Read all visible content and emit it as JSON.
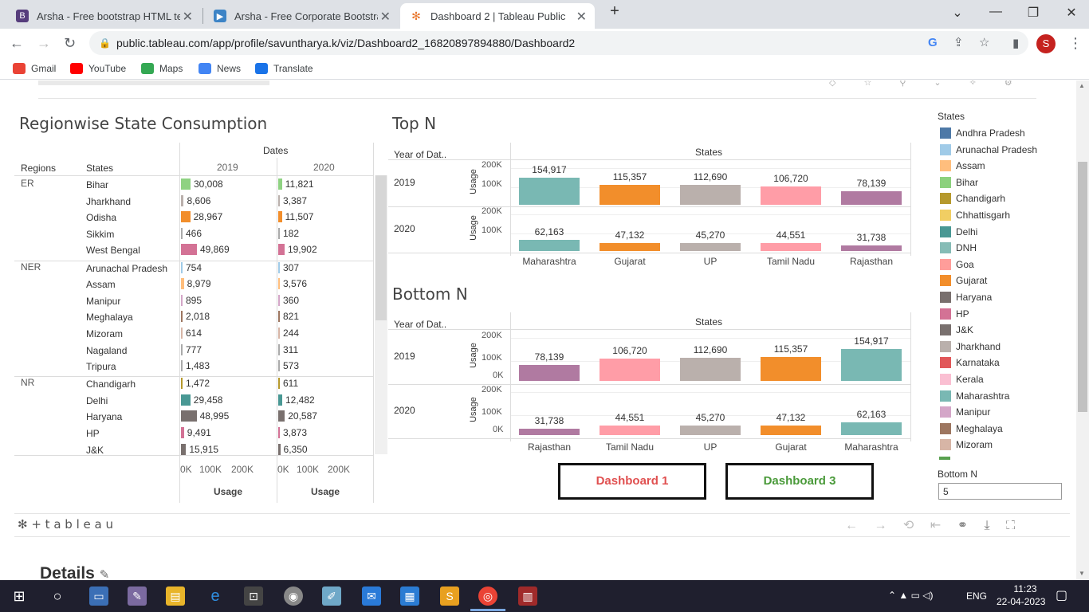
{
  "browser": {
    "tabs": [
      {
        "title": "Arsha - Free bootstrap HTML ten",
        "icon": "bootstrap-icon"
      },
      {
        "title": "Arsha - Free Corporate Bootstrap",
        "icon": "site-icon"
      },
      {
        "title": "Dashboard 2 | Tableau Public",
        "icon": "tableau-icon"
      }
    ],
    "url": "public.tableau.com/app/profile/savuntharya.k/viz/Dashboard2_16820897894880/Dashboard2",
    "avatar": "S",
    "bookmarks": [
      {
        "label": "Gmail",
        "color": "#ea4335"
      },
      {
        "label": "YouTube",
        "color": "#ff0000"
      },
      {
        "label": "Maps",
        "color": "#34a853"
      },
      {
        "label": "News",
        "color": "#4285f4"
      },
      {
        "label": "Translate",
        "color": "#4285f4"
      }
    ]
  },
  "page": {
    "details_label": "Details"
  },
  "viz": {
    "regionwise": {
      "title": "Regionwise State Consumption",
      "dates_header": "Dates",
      "col_regions": "Regions",
      "col_states": "States",
      "years": [
        "2019",
        "2020"
      ],
      "axis_ticks": [
        "0K",
        "100K",
        "200K"
      ],
      "axis_title": "Usage",
      "groups": [
        {
          "region": "ER",
          "rows": [
            {
              "state": "Bihar",
              "v2019": "30,008",
              "v2020": "11,821",
              "n2019": 30008,
              "n2020": 11821,
              "color": "#8fd282"
            },
            {
              "state": "Jharkhand",
              "v2019": "8,606",
              "v2020": "3,387",
              "n2019": 8606,
              "n2020": 3387,
              "color": "#bab0ac"
            },
            {
              "state": "Odisha",
              "v2019": "28,967",
              "v2020": "11,507",
              "n2019": 28967,
              "n2020": 11507,
              "color": "#f28e2b"
            },
            {
              "state": "Sikkim",
              "v2019": "466",
              "v2020": "182",
              "n2019": 466,
              "n2020": 182,
              "color": "#aaaaaa"
            },
            {
              "state": "West Bengal",
              "v2019": "49,869",
              "v2020": "19,902",
              "n2019": 49869,
              "n2020": 19902,
              "color": "#d37295"
            }
          ]
        },
        {
          "region": "NER",
          "rows": [
            {
              "state": "Arunachal Pradesh",
              "v2019": "754",
              "v2020": "307",
              "n2019": 754,
              "n2020": 307,
              "color": "#a0cbe8"
            },
            {
              "state": "Assam",
              "v2019": "8,979",
              "v2020": "3,576",
              "n2019": 8979,
              "n2020": 3576,
              "color": "#ffbe7d"
            },
            {
              "state": "Manipur",
              "v2019": "895",
              "v2020": "360",
              "n2019": 895,
              "n2020": 360,
              "color": "#d4a6c8"
            },
            {
              "state": "Meghalaya",
              "v2019": "2,018",
              "v2020": "821",
              "n2019": 2018,
              "n2020": 821,
              "color": "#9d7660"
            },
            {
              "state": "Mizoram",
              "v2019": "614",
              "v2020": "244",
              "n2019": 614,
              "n2020": 244,
              "color": "#d7b5a6"
            },
            {
              "state": "Nagaland",
              "v2019": "777",
              "v2020": "311",
              "n2019": 777,
              "n2020": 311,
              "color": "#aaaaaa"
            },
            {
              "state": "Tripura",
              "v2019": "1,483",
              "v2020": "573",
              "n2019": 1483,
              "n2020": 573,
              "color": "#aaaaaa"
            }
          ]
        },
        {
          "region": "NR",
          "rows": [
            {
              "state": "Chandigarh",
              "v2019": "1,472",
              "v2020": "611",
              "n2019": 1472,
              "n2020": 611,
              "color": "#b6992d"
            },
            {
              "state": "Delhi",
              "v2019": "29,458",
              "v2020": "12,482",
              "n2019": 29458,
              "n2020": 12482,
              "color": "#499894"
            },
            {
              "state": "Haryana",
              "v2019": "48,995",
              "v2020": "20,587",
              "n2019": 48995,
              "n2020": 20587,
              "color": "#79706e"
            },
            {
              "state": "HP",
              "v2019": "9,491",
              "v2020": "3,873",
              "n2019": 9491,
              "n2020": 3873,
              "color": "#d37295"
            },
            {
              "state": "J&K",
              "v2019": "15,915",
              "v2020": "6,350",
              "n2019": 15915,
              "n2020": 6350,
              "color": "#79706e"
            }
          ]
        }
      ]
    },
    "topn": {
      "title": "Top N",
      "year_header": "Year of Dat..",
      "states_header": "States",
      "axis_title": "Usage",
      "ticks": [
        "200K",
        "100K"
      ],
      "categories": [
        "Maharashtra",
        "Gujarat",
        "UP",
        "Tamil Nadu",
        "Rajasthan"
      ],
      "colors": [
        "#79b8b3",
        "#f28e2b",
        "#bab0ac",
        "#ff9da7",
        "#b07aa1"
      ],
      "rows": [
        {
          "year": "2019",
          "values": [
            154917,
            115357,
            112690,
            106720,
            78139
          ],
          "labels": [
            "154,917",
            "115,357",
            "112,690",
            "106,720",
            "78,139"
          ]
        },
        {
          "year": "2020",
          "values": [
            62163,
            47132,
            45270,
            44551,
            31738
          ],
          "labels": [
            "62,163",
            "47,132",
            "45,270",
            "44,551",
            "31,738"
          ]
        }
      ]
    },
    "bottomn": {
      "title": "Bottom N",
      "year_header": "Year of Dat..",
      "states_header": "States",
      "axis_title": "Usage",
      "ticks": [
        "200K",
        "100K",
        "0K"
      ],
      "categories": [
        "Rajasthan",
        "Tamil Nadu",
        "UP",
        "Gujarat",
        "Maharashtra"
      ],
      "colors": [
        "#b07aa1",
        "#ff9da7",
        "#bab0ac",
        "#f28e2b",
        "#79b8b3"
      ],
      "rows": [
        {
          "year": "2019",
          "values": [
            78139,
            106720,
            112690,
            115357,
            154917
          ],
          "labels": [
            "78,139",
            "106,720",
            "112,690",
            "115,357",
            "154,917"
          ]
        },
        {
          "year": "2020",
          "values": [
            31738,
            44551,
            45270,
            47132,
            62163
          ],
          "labels": [
            "31,738",
            "44,551",
            "45,270",
            "47,132",
            "62,163"
          ]
        }
      ]
    },
    "legend": {
      "title": "States",
      "items": [
        {
          "label": "Andhra Pradesh",
          "color": "#4e79a7"
        },
        {
          "label": "Arunachal Pradesh",
          "color": "#a0cbe8"
        },
        {
          "label": "Assam",
          "color": "#ffbe7d"
        },
        {
          "label": "Bihar",
          "color": "#8cd17d"
        },
        {
          "label": "Chandigarh",
          "color": "#b6992d"
        },
        {
          "label": "Chhattisgarh",
          "color": "#f1ce63"
        },
        {
          "label": "Delhi",
          "color": "#499894"
        },
        {
          "label": "DNH",
          "color": "#86bcb6"
        },
        {
          "label": "Goa",
          "color": "#ff9d9a"
        },
        {
          "label": "Gujarat",
          "color": "#f28e2b"
        },
        {
          "label": "Haryana",
          "color": "#79706e"
        },
        {
          "label": "HP",
          "color": "#d37295"
        },
        {
          "label": "J&K",
          "color": "#79706e"
        },
        {
          "label": "Jharkhand",
          "color": "#bab0ac"
        },
        {
          "label": "Karnataka",
          "color": "#e15759"
        },
        {
          "label": "Kerala",
          "color": "#fabfd2"
        },
        {
          "label": "Maharashtra",
          "color": "#79b8b3"
        },
        {
          "label": "Manipur",
          "color": "#d4a6c8"
        },
        {
          "label": "Meghalaya",
          "color": "#9d7660"
        },
        {
          "label": "Mizoram",
          "color": "#d7b5a6"
        }
      ]
    },
    "bottom_n_param": {
      "label": "Bottom N",
      "value": "5"
    },
    "buttons": {
      "dashboard1": "Dashboard 1",
      "dashboard3": "Dashboard 3",
      "dashboard1_color": "#e05050",
      "dashboard3_color": "#4a9a3a"
    },
    "tableau_logo": "+ t a b l e a u"
  },
  "taskbar": {
    "language": "ENG",
    "time": "11:23",
    "date": "22-04-2023"
  }
}
